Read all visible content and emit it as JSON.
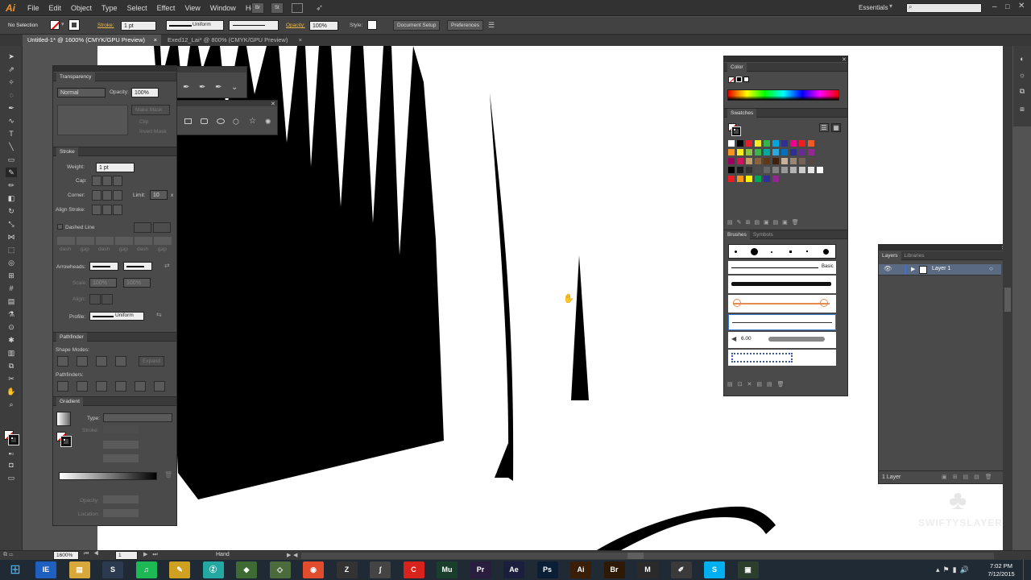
{
  "app": {
    "logo": "Ai"
  },
  "menu": [
    "File",
    "Edit",
    "Object",
    "Type",
    "Select",
    "Effect",
    "View",
    "Window",
    "Help"
  ],
  "menu_icons": {
    "br": "Br",
    "st": "St"
  },
  "workspace": {
    "label": "Essentials",
    "search_placeholder": ""
  },
  "control": {
    "selection": "No Selection",
    "stroke_label": "Stroke:",
    "stroke_weight": "1 pt",
    "stroke_profile": "Uniform",
    "opacity_label": "Opacity:",
    "opacity_value": "100%",
    "style_label": "Style:",
    "document_setup": "Document Setup",
    "preferences": "Preferences"
  },
  "tabs": [
    {
      "label": "Untitled-1* @ 1600% (CMYK/GPU Preview)",
      "close": "×"
    },
    {
      "label": "Exed12_Lai* @ 800% (CMYK/GPU Preview)",
      "close": "×"
    }
  ],
  "transparency": {
    "title": "Transparency",
    "blend": "Normal",
    "opacity_label": "Opacity:",
    "opacity": "100%",
    "make_mask": "Make Mask",
    "clip": "Clip",
    "invert": "Invert Mask"
  },
  "stroke_panel": {
    "title": "Stroke",
    "weight_label": "Weight:",
    "weight": "1 pt",
    "cap_label": "Cap:",
    "corner_label": "Corner:",
    "limit_label": "Limit:",
    "limit": "10",
    "limit_unit": "x",
    "align_label": "Align Stroke:",
    "dashed": "Dashed Line",
    "dash_labels": [
      "dash",
      "gap",
      "dash",
      "gap",
      "dash",
      "gap"
    ],
    "arrowheads_label": "Arrowheads:",
    "scale_label": "Scale:",
    "scale_1": "100%",
    "scale_2": "100%",
    "align2_label": "Align:",
    "profile_label": "Profile:",
    "profile": "Uniform"
  },
  "pathfinder": {
    "title": "Pathfinder",
    "shape_modes": "Shape Modes:",
    "pathfinders": "Pathfinders:",
    "expand": "Expand"
  },
  "gradient": {
    "title": "Gradient",
    "type_label": "Type:",
    "stroke_label": "Stroke:",
    "opacity_label": "Opacity:",
    "location_label": "Location:"
  },
  "color_panel": {
    "title": "Color"
  },
  "swatches": {
    "title": "Swatches",
    "rows": [
      [
        "#ffffff",
        "#000000",
        "#e4202a",
        "#f7eb1e",
        "#37b44a",
        "#00a5e0",
        "#2e3192",
        "#ec008c",
        "#ee1d24",
        "#f15a24"
      ],
      [
        "#f7931e",
        "#fcee21",
        "#8cc63f",
        "#39b54a",
        "#00a99d",
        "#29abe2",
        "#0071bc",
        "#2e3192",
        "#662d91",
        "#93278f"
      ],
      [
        "#9e005d",
        "#d4145a",
        "#c69c6d",
        "#8c6239",
        "#603813",
        "#42210b",
        "#c7b299",
        "#998675",
        "#736357",
        "#534741"
      ],
      [
        "#000000",
        "#1a1a1a",
        "#333333",
        "#4d4d4d",
        "#666666",
        "#808080",
        "#999999",
        "#b3b3b3",
        "#cccccc",
        "#e6e6e6",
        "#ffffff"
      ],
      [
        "#ed1c24",
        "#f7941d",
        "#fff200",
        "#00a651",
        "#2e3192",
        "#92278f"
      ]
    ]
  },
  "brushes": {
    "title": "Brushes",
    "symbols_tab": "Symbols",
    "basic": "Basic",
    "size": "6.00"
  },
  "layers": {
    "title": "Layers",
    "libraries_tab": "Libraries",
    "layer1": "Layer 1",
    "count": "1 Layer"
  },
  "status": {
    "zoom": "1600%",
    "artboard": "1",
    "tool": "Hand"
  },
  "clock": {
    "time": "7:02 PM",
    "date": "7/12/2015"
  },
  "watermark": "SWIFTYSLAYER",
  "taskbar_apps": [
    {
      "label": "IE",
      "color": "#1e5fbf"
    },
    {
      "label": "▤",
      "color": "#d8a93a"
    },
    {
      "label": "S",
      "color": "#2b3a4e"
    },
    {
      "label": "♫",
      "color": "#1db954"
    },
    {
      "label": "✎",
      "color": "#d0a020"
    },
    {
      "label": "Ⓩ",
      "color": "#24a8a2"
    },
    {
      "label": "◆",
      "color": "#3d6b33"
    },
    {
      "label": "◇",
      "color": "#4b6b3d"
    },
    {
      "label": "◉",
      "color": "#e14c2d"
    },
    {
      "label": "Z",
      "color": "#333333"
    },
    {
      "label": "∫",
      "color": "#444444"
    },
    {
      "label": "C",
      "color": "#d8231c"
    },
    {
      "label": "Mu",
      "color": "#1a3e2c"
    },
    {
      "label": "Pr",
      "color": "#2a1e3e"
    },
    {
      "label": "Ae",
      "color": "#1c1e3e"
    },
    {
      "label": "Ps",
      "color": "#0a1f36"
    },
    {
      "label": "Ai",
      "color": "#3a1e08"
    },
    {
      "label": "Br",
      "color": "#2e1a04"
    },
    {
      "label": "M",
      "color": "#2a2a2a"
    },
    {
      "label": "✐",
      "color": "#3a3a3a"
    },
    {
      "label": "S",
      "color": "#00aff0"
    },
    {
      "label": "▣",
      "color": "#2c3e2c"
    }
  ]
}
